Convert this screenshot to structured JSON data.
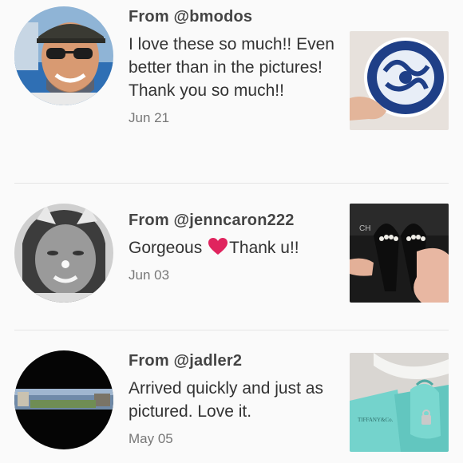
{
  "reviews": [
    {
      "from": "From @bmodos",
      "text": "I love these so much!! Even better than in the pictures! Thank you so much!!",
      "date": "Jun 21",
      "avatar_icon": "user-avatar-photo",
      "thumb_icon": "blue-white-dish-photo"
    },
    {
      "from": "From @jenncaron222",
      "text_before": "Gorgeous ",
      "text_after": "Thank u!!",
      "emoji": "red-heart",
      "date": "Jun 03",
      "avatar_icon": "user-avatar-photo",
      "thumb_icon": "black-heels-photo"
    },
    {
      "from": "From @jadler2",
      "text": "Arrived quickly and just as pictured. Love it.",
      "date": "May 05",
      "avatar_icon": "user-avatar-photo",
      "thumb_icon": "tiffany-box-photo"
    }
  ],
  "colors": {
    "background": "#fafafa",
    "heart": "#e0245e",
    "tiffany_blue": "#6fd0c8"
  }
}
